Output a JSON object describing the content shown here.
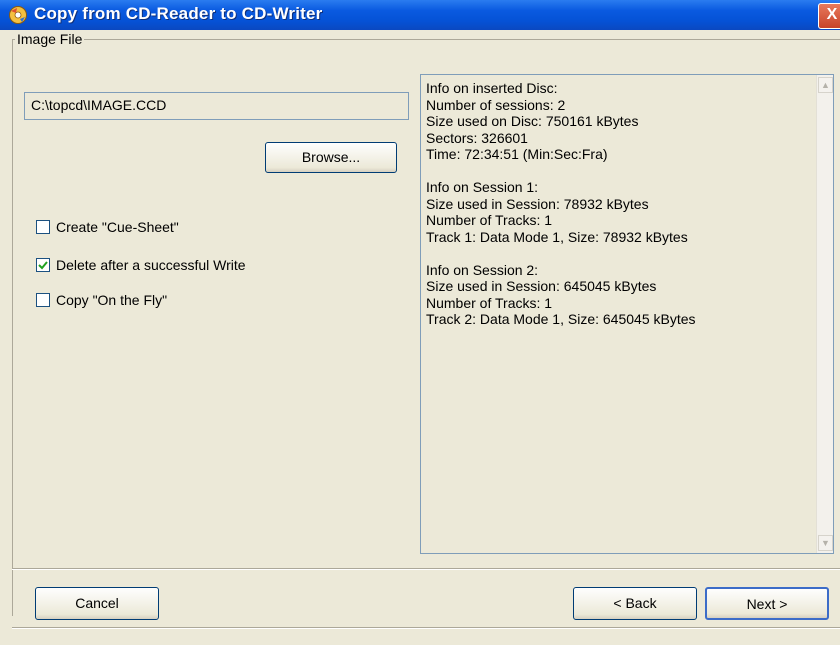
{
  "window": {
    "title": "Copy from CD-Reader to CD-Writer",
    "close_glyph": "X"
  },
  "image_file": {
    "group_label": "Image File",
    "path_value": "C:\\topcd\\IMAGE.CCD",
    "browse_label": "Browse..."
  },
  "options": [
    {
      "label": "Create \"Cue-Sheet\"",
      "checked": false
    },
    {
      "label": "Delete after a successful Write",
      "checked": true
    },
    {
      "label": "Copy \"On the Fly\"",
      "checked": false
    }
  ],
  "info": {
    "text": "Info on inserted Disc:\nNumber of sessions: 2\nSize used on Disc: 750161 kBytes\nSectors: 326601\nTime: 72:34:51 (Min:Sec:Fra)\n\nInfo on Session 1:\nSize used in Session: 78932 kBytes\nNumber of Tracks: 1\nTrack 1: Data Mode 1, Size: 78932 kBytes\n\nInfo on Session 2:\nSize used in Session: 645045 kBytes\nNumber of Tracks: 1\nTrack 2: Data Mode 1, Size: 645045 kBytes"
  },
  "buttons": {
    "cancel": "Cancel",
    "back": "< Back",
    "next": "Next >"
  },
  "icons": {
    "title": "cd-copy-app-icon",
    "scroll_up": "scroll-up-icon",
    "scroll_down": "scroll-down-icon",
    "check": "checkmark-icon"
  },
  "colors": {
    "titlebar": "#0552d6",
    "dialog_bg": "#ece9d8",
    "checkmark": "#21a121",
    "close_button": "#c8432a"
  }
}
